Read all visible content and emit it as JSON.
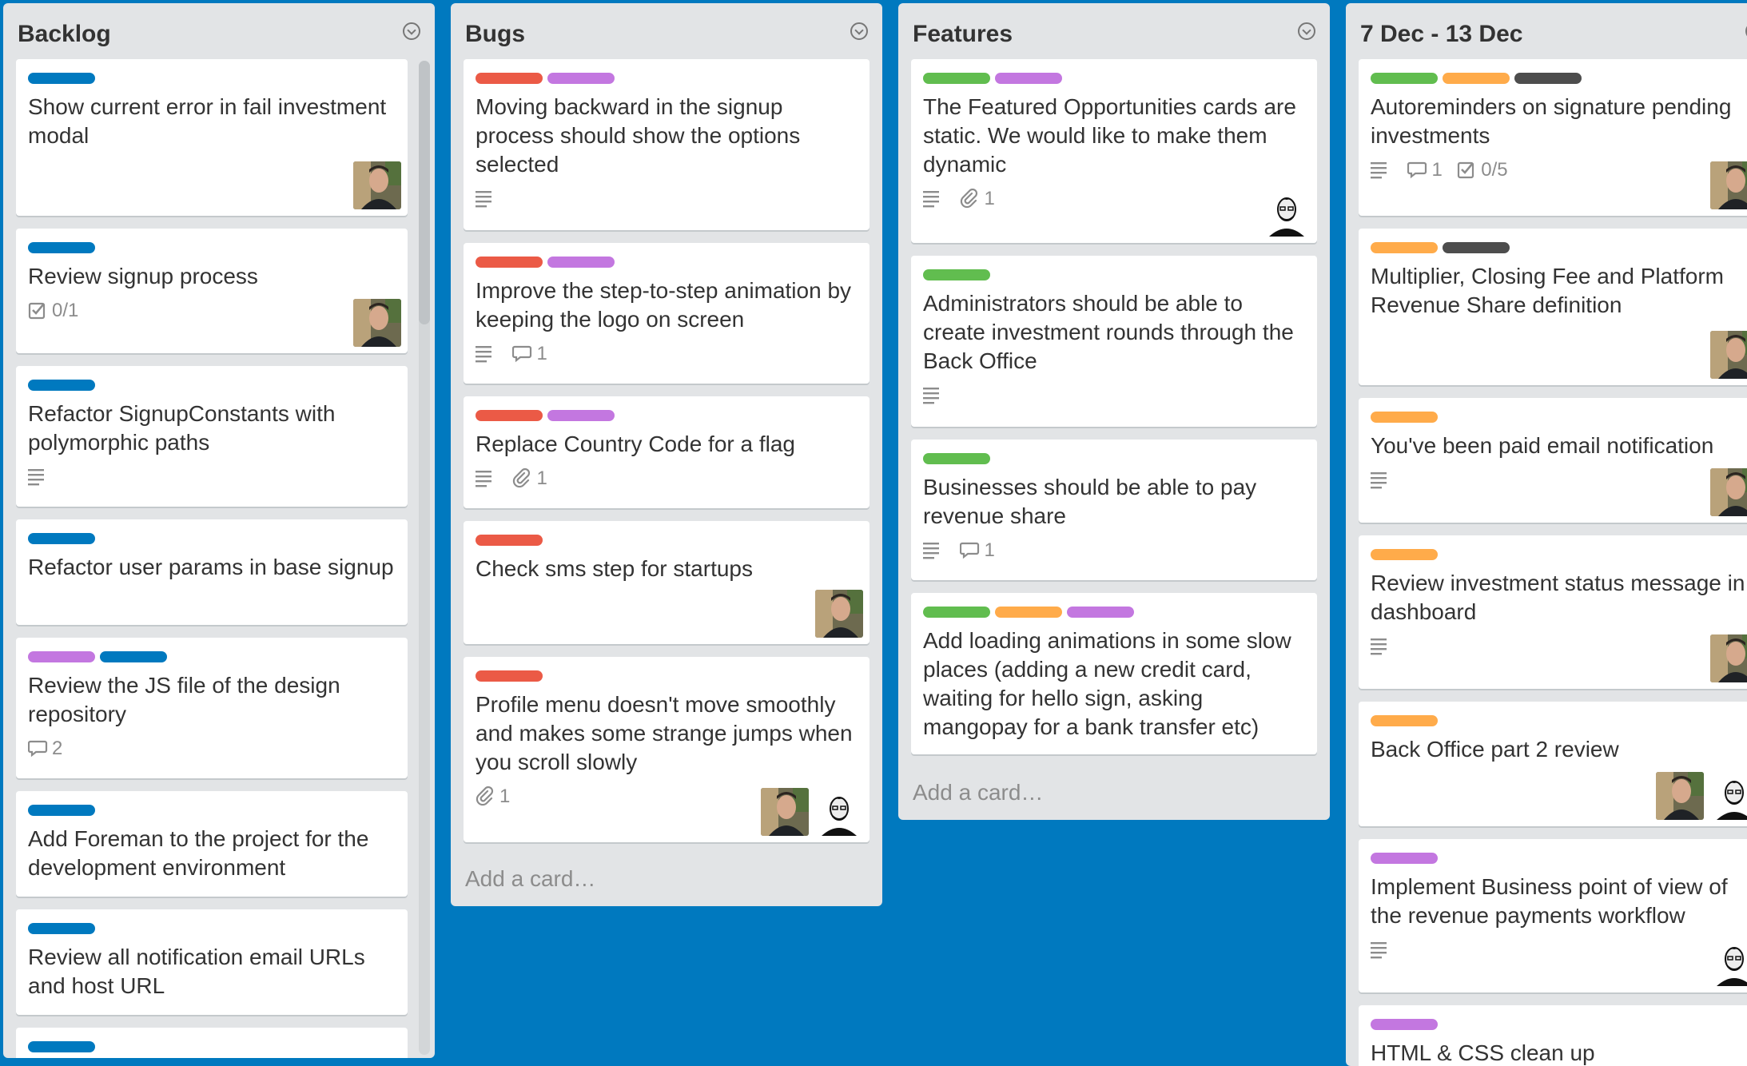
{
  "colors": {
    "board_bg": "#0079bf",
    "label_blue": "#0079bf",
    "label_green": "#61bd4f",
    "label_orange": "#ffab4a",
    "label_red": "#eb5a46",
    "label_purple": "#c377e0",
    "label_black": "#4d4d4d"
  },
  "icons": {
    "description": "description-icon",
    "comment": "comment-icon",
    "attachment": "attachment-icon",
    "checklist": "checklist-icon",
    "list_menu": "chevron-circle-icon"
  },
  "add_card_text": "Add a card…",
  "lists": [
    {
      "title": "Backlog",
      "cards": [
        {
          "title": "Show current error in fail investment modal"
        },
        {
          "title": "Review signup process",
          "checklist": "0/1"
        },
        {
          "title": "Refactor SignupConstants with polymorphic paths"
        },
        {
          "title": "Refactor user params in base signup"
        },
        {
          "title": "Review the JS file of the design repository",
          "comments": "2"
        },
        {
          "title": "Add Foreman to the project for the development environment"
        },
        {
          "title": "Review all notification email URLs and host URL"
        }
      ]
    },
    {
      "title": "Bugs",
      "cards": [
        {
          "title": "Moving backward in the signup process should show the options selected"
        },
        {
          "title": "Improve the step-to-step animation by keeping the logo on screen",
          "comments": "1"
        },
        {
          "title": "Replace Country Code for a flag",
          "attachments": "1"
        },
        {
          "title": "Check sms step for startups"
        },
        {
          "title": "Profile menu doesn't move smoothly and makes some strange jumps when you scroll slowly",
          "attachments": "1"
        }
      ]
    },
    {
      "title": "Features",
      "cards": [
        {
          "title": "The Featured Opportunities cards are static. We would like to make them dynamic",
          "attachments": "1"
        },
        {
          "title": "Administrators should be able to create investment rounds through the Back Office"
        },
        {
          "title": "Businesses should be able to pay revenue share",
          "comments": "1"
        },
        {
          "title": "Add loading animations in some slow places (adding a new credit card, waiting for hello sign, asking mangopay for a bank transfer etc)"
        }
      ]
    },
    {
      "title": "7 Dec - 13 Dec",
      "cards": [
        {
          "title": "Autoreminders on signature pending investments",
          "comments": "1",
          "checklist": "0/5"
        },
        {
          "title": "Multiplier, Closing Fee and Platform Revenue Share definition"
        },
        {
          "title": "You've been paid email notification"
        },
        {
          "title": "Review investment status message in dashboard"
        },
        {
          "title": "Back Office part 2 review"
        },
        {
          "title": "Implement Business point of view of the revenue payments workflow"
        },
        {
          "title": "HTML & CSS clean up"
        }
      ]
    }
  ]
}
